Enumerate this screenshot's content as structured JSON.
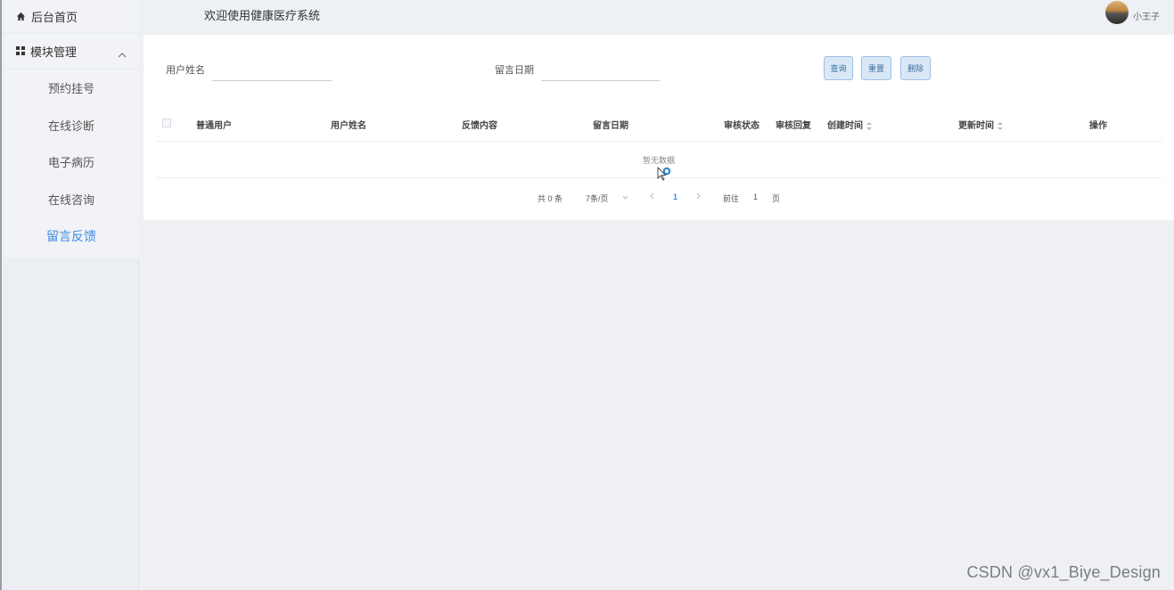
{
  "sidebar": {
    "home_label": "后台首页",
    "module_label": "模块管理",
    "items": [
      {
        "label": "预约挂号"
      },
      {
        "label": "在线诊断"
      },
      {
        "label": "电子病历"
      },
      {
        "label": "在线咨询"
      },
      {
        "label": "留言反馈"
      }
    ],
    "active_index": 4
  },
  "header": {
    "welcome": "欢迎使用健康医疗系统",
    "username": "小王子"
  },
  "search": {
    "user_name_label": "用户姓名",
    "user_name_value": "",
    "date_label": "留言日期",
    "date_value": ""
  },
  "buttons": {
    "query": "查询",
    "reset": "重置",
    "delete": "删除"
  },
  "table": {
    "columns": [
      "普通用户",
      "用户姓名",
      "反馈内容",
      "留言日期",
      "审核状态",
      "审核回复",
      "创建时间",
      "更新时间",
      "操作"
    ],
    "rows": [],
    "empty_text": "暂无数据"
  },
  "pagination": {
    "total": "共 0 条",
    "page_size": "7条/页",
    "current_page": "1",
    "goto_label": "前往",
    "goto_value": "1",
    "page_suffix": "页"
  },
  "watermark": "CSDN @vx1_Biye_Design",
  "colors": {
    "accent": "#3a8ee6",
    "sidebar_bg": "#ebeef3",
    "button_bg": "#d9e8f5"
  }
}
